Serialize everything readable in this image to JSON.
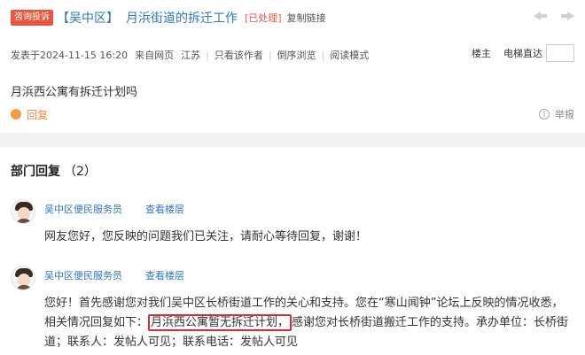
{
  "header": {
    "badge": "咨询投诉",
    "forum": "【吴中区】",
    "title": "月浜街道的拆迁工作",
    "status": "[已处理]",
    "copy_link": "复制链接"
  },
  "meta": {
    "posted": "发表于2024-11-15 16:20",
    "source": "来自网页",
    "region": "江苏",
    "only_author": "只看该作者",
    "reverse": "倒序浏览",
    "read_mode": "阅读模式",
    "floor_owner": "楼主",
    "elevator": "电梯直达"
  },
  "post": {
    "content": "月浜西公寓有拆迁计划吗",
    "reply_label": "回复",
    "report_label": "举报"
  },
  "replies_section": {
    "title": "部门回复",
    "count": "（2）"
  },
  "replies": [
    {
      "name": "吴中区便民服务员",
      "view_floor": "查看楼层",
      "text": "网友您好，您反映的问题我们已关注，请耐心等待回复，谢谢！"
    },
    {
      "name": "吴中区便民服务员",
      "view_floor": "查看楼层",
      "text_before": "您好！首先感谢您对我们吴中区长桥街道工作的关心和支持。您在“寒山闻钟”论坛上反映的情况收悉，相关情况回复如下：",
      "highlight": "月浜西公寓暂无拆迁计划，",
      "text_after": "感谢您对长桥街道搬迁工作的支持。承办单位：长桥街道；联系人：发帖人可见；联系电话：发帖人可见"
    }
  ],
  "icons": {
    "prev": "arrow-left-icon",
    "next": "arrow-right-icon",
    "reply": "comment-icon",
    "report": "info-icon"
  },
  "colors": {
    "link": "#2f76c5",
    "badge": "#e9573f",
    "highlight_border": "#d22f2f",
    "reply_accent": "#f0883a"
  }
}
